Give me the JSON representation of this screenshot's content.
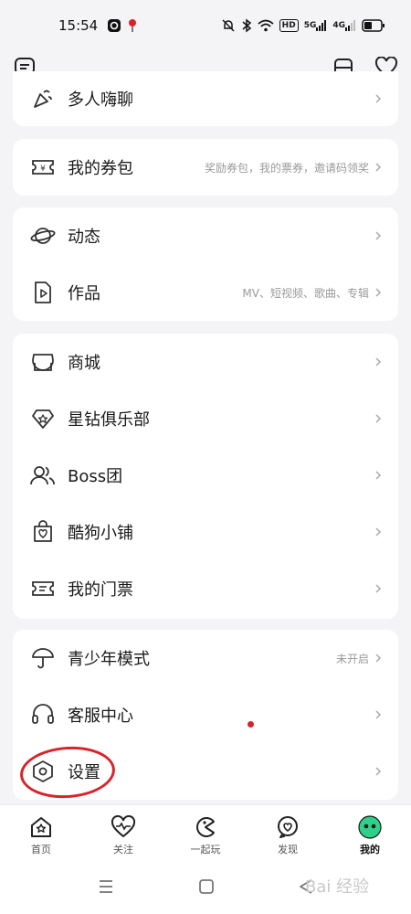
{
  "status_bar": {
    "time": "15:54",
    "network_label": "5G",
    "network_label_2": "4G",
    "hd_label": "HD"
  },
  "menu": {
    "party": {
      "label": "多人嗨聊"
    },
    "coupon": {
      "label": "我的券包",
      "hint": "奖励券包，我的票券，邀请码领奖"
    },
    "dynamic": {
      "label": "动态"
    },
    "works": {
      "label": "作品",
      "hint": "MV、短视频、歌曲、专辑"
    },
    "mall": {
      "label": "商城"
    },
    "star_club": {
      "label": "星钻俱乐部"
    },
    "boss": {
      "label": "Boss团"
    },
    "shop": {
      "label": "酷狗小铺"
    },
    "tickets": {
      "label": "我的门票"
    },
    "youth": {
      "label": "青少年模式",
      "hint": "未开启"
    },
    "service": {
      "label": "客服中心"
    },
    "settings": {
      "label": "设置"
    }
  },
  "tabs": [
    {
      "label": "首页"
    },
    {
      "label": "关注"
    },
    {
      "label": "一起玩"
    },
    {
      "label": "发现"
    },
    {
      "label": "我的"
    }
  ],
  "watermark": "Bai 经验",
  "colors": {
    "accent": "#2ed187",
    "annotation": "#d8232a"
  }
}
